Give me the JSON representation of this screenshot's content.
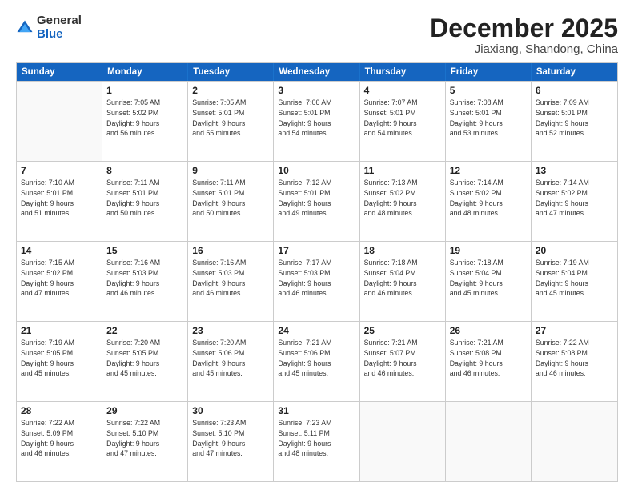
{
  "header": {
    "logo_general": "General",
    "logo_blue": "Blue",
    "month_title": "December 2025",
    "location": "Jiaxiang, Shandong, China"
  },
  "weekdays": [
    "Sunday",
    "Monday",
    "Tuesday",
    "Wednesday",
    "Thursday",
    "Friday",
    "Saturday"
  ],
  "weeks": [
    [
      {
        "day": "",
        "empty": true
      },
      {
        "day": "1",
        "sunrise": "7:05 AM",
        "sunset": "5:02 PM",
        "daylight": "9 hours and 56 minutes."
      },
      {
        "day": "2",
        "sunrise": "7:05 AM",
        "sunset": "5:01 PM",
        "daylight": "9 hours and 55 minutes."
      },
      {
        "day": "3",
        "sunrise": "7:06 AM",
        "sunset": "5:01 PM",
        "daylight": "9 hours and 54 minutes."
      },
      {
        "day": "4",
        "sunrise": "7:07 AM",
        "sunset": "5:01 PM",
        "daylight": "9 hours and 54 minutes."
      },
      {
        "day": "5",
        "sunrise": "7:08 AM",
        "sunset": "5:01 PM",
        "daylight": "9 hours and 53 minutes."
      },
      {
        "day": "6",
        "sunrise": "7:09 AM",
        "sunset": "5:01 PM",
        "daylight": "9 hours and 52 minutes."
      }
    ],
    [
      {
        "day": "7",
        "sunrise": "7:10 AM",
        "sunset": "5:01 PM",
        "daylight": "9 hours and 51 minutes."
      },
      {
        "day": "8",
        "sunrise": "7:11 AM",
        "sunset": "5:01 PM",
        "daylight": "9 hours and 50 minutes."
      },
      {
        "day": "9",
        "sunrise": "7:11 AM",
        "sunset": "5:01 PM",
        "daylight": "9 hours and 50 minutes."
      },
      {
        "day": "10",
        "sunrise": "7:12 AM",
        "sunset": "5:01 PM",
        "daylight": "9 hours and 49 minutes."
      },
      {
        "day": "11",
        "sunrise": "7:13 AM",
        "sunset": "5:02 PM",
        "daylight": "9 hours and 48 minutes."
      },
      {
        "day": "12",
        "sunrise": "7:14 AM",
        "sunset": "5:02 PM",
        "daylight": "9 hours and 48 minutes."
      },
      {
        "day": "13",
        "sunrise": "7:14 AM",
        "sunset": "5:02 PM",
        "daylight": "9 hours and 47 minutes."
      }
    ],
    [
      {
        "day": "14",
        "sunrise": "7:15 AM",
        "sunset": "5:02 PM",
        "daylight": "9 hours and 47 minutes."
      },
      {
        "day": "15",
        "sunrise": "7:16 AM",
        "sunset": "5:03 PM",
        "daylight": "9 hours and 46 minutes."
      },
      {
        "day": "16",
        "sunrise": "7:16 AM",
        "sunset": "5:03 PM",
        "daylight": "9 hours and 46 minutes."
      },
      {
        "day": "17",
        "sunrise": "7:17 AM",
        "sunset": "5:03 PM",
        "daylight": "9 hours and 46 minutes."
      },
      {
        "day": "18",
        "sunrise": "7:18 AM",
        "sunset": "5:04 PM",
        "daylight": "9 hours and 46 minutes."
      },
      {
        "day": "19",
        "sunrise": "7:18 AM",
        "sunset": "5:04 PM",
        "daylight": "9 hours and 45 minutes."
      },
      {
        "day": "20",
        "sunrise": "7:19 AM",
        "sunset": "5:04 PM",
        "daylight": "9 hours and 45 minutes."
      }
    ],
    [
      {
        "day": "21",
        "sunrise": "7:19 AM",
        "sunset": "5:05 PM",
        "daylight": "9 hours and 45 minutes."
      },
      {
        "day": "22",
        "sunrise": "7:20 AM",
        "sunset": "5:05 PM",
        "daylight": "9 hours and 45 minutes."
      },
      {
        "day": "23",
        "sunrise": "7:20 AM",
        "sunset": "5:06 PM",
        "daylight": "9 hours and 45 minutes."
      },
      {
        "day": "24",
        "sunrise": "7:21 AM",
        "sunset": "5:06 PM",
        "daylight": "9 hours and 45 minutes."
      },
      {
        "day": "25",
        "sunrise": "7:21 AM",
        "sunset": "5:07 PM",
        "daylight": "9 hours and 46 minutes."
      },
      {
        "day": "26",
        "sunrise": "7:21 AM",
        "sunset": "5:08 PM",
        "daylight": "9 hours and 46 minutes."
      },
      {
        "day": "27",
        "sunrise": "7:22 AM",
        "sunset": "5:08 PM",
        "daylight": "9 hours and 46 minutes."
      }
    ],
    [
      {
        "day": "28",
        "sunrise": "7:22 AM",
        "sunset": "5:09 PM",
        "daylight": "9 hours and 46 minutes."
      },
      {
        "day": "29",
        "sunrise": "7:22 AM",
        "sunset": "5:10 PM",
        "daylight": "9 hours and 47 minutes."
      },
      {
        "day": "30",
        "sunrise": "7:23 AM",
        "sunset": "5:10 PM",
        "daylight": "9 hours and 47 minutes."
      },
      {
        "day": "31",
        "sunrise": "7:23 AM",
        "sunset": "5:11 PM",
        "daylight": "9 hours and 48 minutes."
      },
      {
        "day": "",
        "empty": true
      },
      {
        "day": "",
        "empty": true
      },
      {
        "day": "",
        "empty": true
      }
    ]
  ]
}
